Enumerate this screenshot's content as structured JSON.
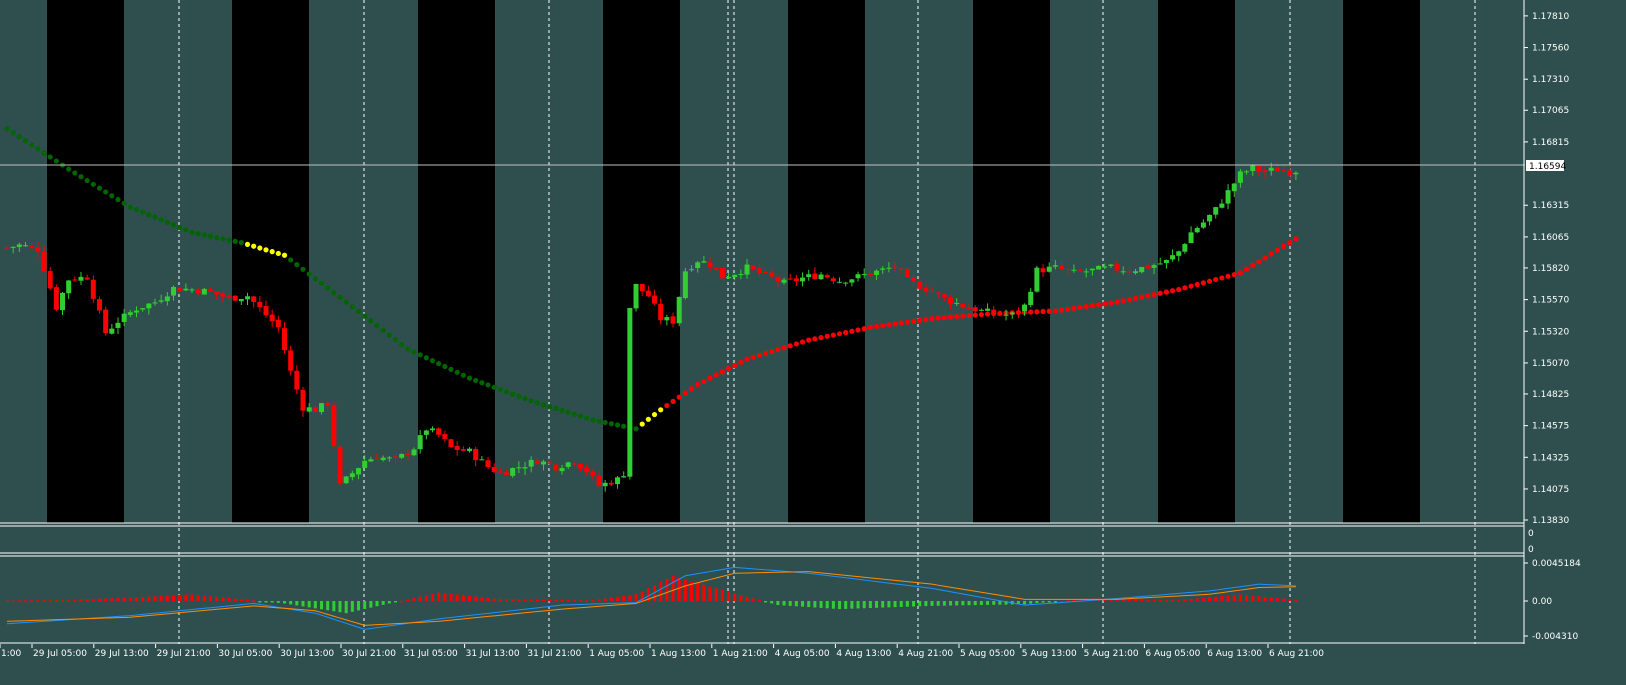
{
  "colors": {
    "background": "#2f4f4f",
    "band": "#000000",
    "axis": "#ffffff",
    "bull_candle": "#32cd32",
    "bear_candle": "#ff0000",
    "dot_green": "#006400",
    "dot_yellow": "#ffff00",
    "dot_red": "#ff0000",
    "macd_pos": "#ff0000",
    "macd_neg": "#32cd32",
    "signal_blue": "#1e90ff",
    "signal_orange": "#ff8c00"
  },
  "current_price": "1.16594",
  "chart_data": [
    {
      "type": "candlestick",
      "y_ticks": [
        "1.17810",
        "1.17560",
        "1.17310",
        "1.17065",
        "1.16815",
        "1.16315",
        "1.16065",
        "1.15820",
        "1.15570",
        "1.15320",
        "1.15070",
        "1.14825",
        "1.14575",
        "1.14325",
        "1.14075",
        "1.13830"
      ],
      "ylim": [
        1.1383,
        1.1788
      ],
      "x_tick_labels": [
        "1:00",
        "29 Jul 05:00",
        "29 Jul 13:00",
        "29 Jul 21:00",
        "30 Jul 05:00",
        "30 Jul 13:00",
        "30 Jul 21:00",
        "31 Jul 05:00",
        "31 Jul 13:00",
        "31 Jul 21:00",
        "1 Aug 05:00",
        "1 Aug 13:00",
        "1 Aug 21:00",
        "4 Aug 05:00",
        "4 Aug 13:00",
        "4 Aug 21:00",
        "5 Aug 05:00",
        "5 Aug 13:00",
        "5 Aug 21:00",
        "6 Aug 05:00",
        "6 Aug 13:00",
        "6 Aug 21:00"
      ],
      "close_anchors": [
        [
          0,
          1.1598
        ],
        [
          2,
          1.16
        ],
        [
          5,
          1.1597
        ],
        [
          8,
          1.1551
        ],
        [
          10,
          1.1573
        ],
        [
          13,
          1.1575
        ],
        [
          16,
          1.1531
        ],
        [
          18,
          1.154
        ],
        [
          21,
          1.155
        ],
        [
          24,
          1.1555
        ],
        [
          27,
          1.1566
        ],
        [
          30,
          1.1565
        ],
        [
          33,
          1.1563
        ],
        [
          36,
          1.1558
        ],
        [
          39,
          1.156
        ],
        [
          42,
          1.1545
        ],
        [
          44,
          1.1535
        ],
        [
          46,
          1.15
        ],
        [
          48,
          1.1472
        ],
        [
          50,
          1.147
        ],
        [
          52,
          1.1475
        ],
        [
          54,
          1.141
        ],
        [
          56,
          1.142
        ],
        [
          58,
          1.143
        ],
        [
          60,
          1.1433
        ],
        [
          63,
          1.143
        ],
        [
          66,
          1.144
        ],
        [
          68,
          1.1455
        ],
        [
          70,
          1.145
        ],
        [
          72,
          1.144
        ],
        [
          75,
          1.1437
        ],
        [
          78,
          1.1425
        ],
        [
          80,
          1.142
        ],
        [
          83,
          1.1425
        ],
        [
          86,
          1.143
        ],
        [
          89,
          1.1425
        ],
        [
          92,
          1.143
        ],
        [
          94,
          1.1422
        ],
        [
          96,
          1.141
        ],
        [
          99,
          1.1415
        ],
        [
          100,
          1.142
        ],
        [
          101,
          1.1551
        ],
        [
          102,
          1.1568
        ],
        [
          104,
          1.156
        ],
        [
          106,
          1.1542
        ],
        [
          108,
          1.154
        ],
        [
          110,
          1.158
        ],
        [
          112,
          1.1588
        ],
        [
          114,
          1.1585
        ],
        [
          116,
          1.1575
        ],
        [
          118,
          1.1578
        ],
        [
          120,
          1.1582
        ],
        [
          123,
          1.1576
        ],
        [
          126,
          1.157
        ],
        [
          129,
          1.1574
        ],
        [
          132,
          1.1577
        ],
        [
          135,
          1.1572
        ],
        [
          138,
          1.1575
        ],
        [
          141,
          1.1579
        ],
        [
          144,
          1.1583
        ],
        [
          146,
          1.1572
        ],
        [
          149,
          1.1566
        ],
        [
          152,
          1.1558
        ],
        [
          155,
          1.1552
        ],
        [
          158,
          1.1548
        ],
        [
          161,
          1.1545
        ],
        [
          163,
          1.1545
        ],
        [
          165,
          1.1552
        ],
        [
          167,
          1.158
        ],
        [
          170,
          1.1582
        ],
        [
          173,
          1.1578
        ],
        [
          176,
          1.158
        ],
        [
          179,
          1.1582
        ],
        [
          182,
          1.158
        ],
        [
          185,
          1.1583
        ],
        [
          188,
          1.1587
        ],
        [
          190,
          1.1595
        ],
        [
          192,
          1.161
        ],
        [
          194,
          1.1618
        ],
        [
          196,
          1.1628
        ],
        [
          198,
          1.1642
        ],
        [
          200,
          1.1656
        ],
        [
          202,
          1.1661
        ],
        [
          204,
          1.1658
        ],
        [
          206,
          1.166
        ],
        [
          208,
          1.1658
        ],
        [
          209,
          1.1659
        ]
      ],
      "moving_average_dots": [
        {
          "color": "green",
          "from": 0,
          "to": 38
        },
        {
          "color": "yellow",
          "from": 39,
          "to": 45
        },
        {
          "color": "green",
          "from": 46,
          "to": 102
        },
        {
          "color": "yellow",
          "from": 103,
          "to": 106
        },
        {
          "color": "red",
          "from": 107,
          "to": 209
        }
      ],
      "ma_anchors": [
        [
          0,
          1.1692
        ],
        [
          10,
          1.166
        ],
        [
          20,
          1.163
        ],
        [
          30,
          1.161
        ],
        [
          38,
          1.1602
        ],
        [
          45,
          1.1592
        ],
        [
          55,
          1.1555
        ],
        [
          65,
          1.1518
        ],
        [
          75,
          1.1495
        ],
        [
          85,
          1.1477
        ],
        [
          95,
          1.1462
        ],
        [
          102,
          1.1455
        ],
        [
          106,
          1.147
        ],
        [
          112,
          1.149
        ],
        [
          120,
          1.151
        ],
        [
          130,
          1.1525
        ],
        [
          140,
          1.1535
        ],
        [
          150,
          1.1542
        ],
        [
          160,
          1.1546
        ],
        [
          170,
          1.1548
        ],
        [
          180,
          1.1555
        ],
        [
          190,
          1.1565
        ],
        [
          200,
          1.1578
        ],
        [
          209,
          1.1605
        ]
      ]
    },
    {
      "type": "macd_histogram",
      "y_ticks": [
        "0.0045184",
        "0.00",
        "-0.004310"
      ],
      "ylim": [
        -0.00431,
        0.0045184
      ],
      "histogram_anchors": [
        [
          0,
          5e-05
        ],
        [
          10,
          0.0001
        ],
        [
          20,
          0.0004
        ],
        [
          30,
          0.0008
        ],
        [
          38,
          0.0002
        ],
        [
          45,
          -0.0003
        ],
        [
          55,
          -0.0015
        ],
        [
          62,
          -0.0003
        ],
        [
          70,
          0.001
        ],
        [
          80,
          0.0002
        ],
        [
          95,
          0.0001
        ],
        [
          102,
          0.0008
        ],
        [
          108,
          0.003
        ],
        [
          115,
          0.0015
        ],
        [
          125,
          -0.0005
        ],
        [
          135,
          -0.001
        ],
        [
          150,
          -0.0006
        ],
        [
          165,
          -0.0004
        ],
        [
          175,
          0.0003
        ],
        [
          190,
          0.0001
        ],
        [
          200,
          0.0008
        ],
        [
          209,
          0.0001
        ]
      ],
      "line_blue_anchors": [
        [
          0,
          -0.0028
        ],
        [
          20,
          -0.0018
        ],
        [
          40,
          -0.0003
        ],
        [
          50,
          -0.0015
        ],
        [
          58,
          -0.0035
        ],
        [
          70,
          -0.0022
        ],
        [
          90,
          -0.0005
        ],
        [
          102,
          -0.0002
        ],
        [
          110,
          0.003
        ],
        [
          118,
          0.004
        ],
        [
          130,
          0.0033
        ],
        [
          150,
          0.0015
        ],
        [
          165,
          -0.0005
        ],
        [
          180,
          0.0003
        ],
        [
          195,
          0.0012
        ],
        [
          203,
          0.002
        ],
        [
          209,
          0.0018
        ]
      ],
      "line_orange_anchors": [
        [
          0,
          -0.0025
        ],
        [
          20,
          -0.002
        ],
        [
          40,
          -0.0006
        ],
        [
          50,
          -0.0012
        ],
        [
          58,
          -0.003
        ],
        [
          70,
          -0.0025
        ],
        [
          90,
          -0.001
        ],
        [
          102,
          -0.0003
        ],
        [
          110,
          0.0018
        ],
        [
          118,
          0.0033
        ],
        [
          130,
          0.0035
        ],
        [
          150,
          0.002
        ],
        [
          165,
          0.0002
        ],
        [
          180,
          0.0002
        ],
        [
          195,
          0.0008
        ],
        [
          203,
          0.0016
        ],
        [
          209,
          0.0017
        ]
      ]
    }
  ]
}
